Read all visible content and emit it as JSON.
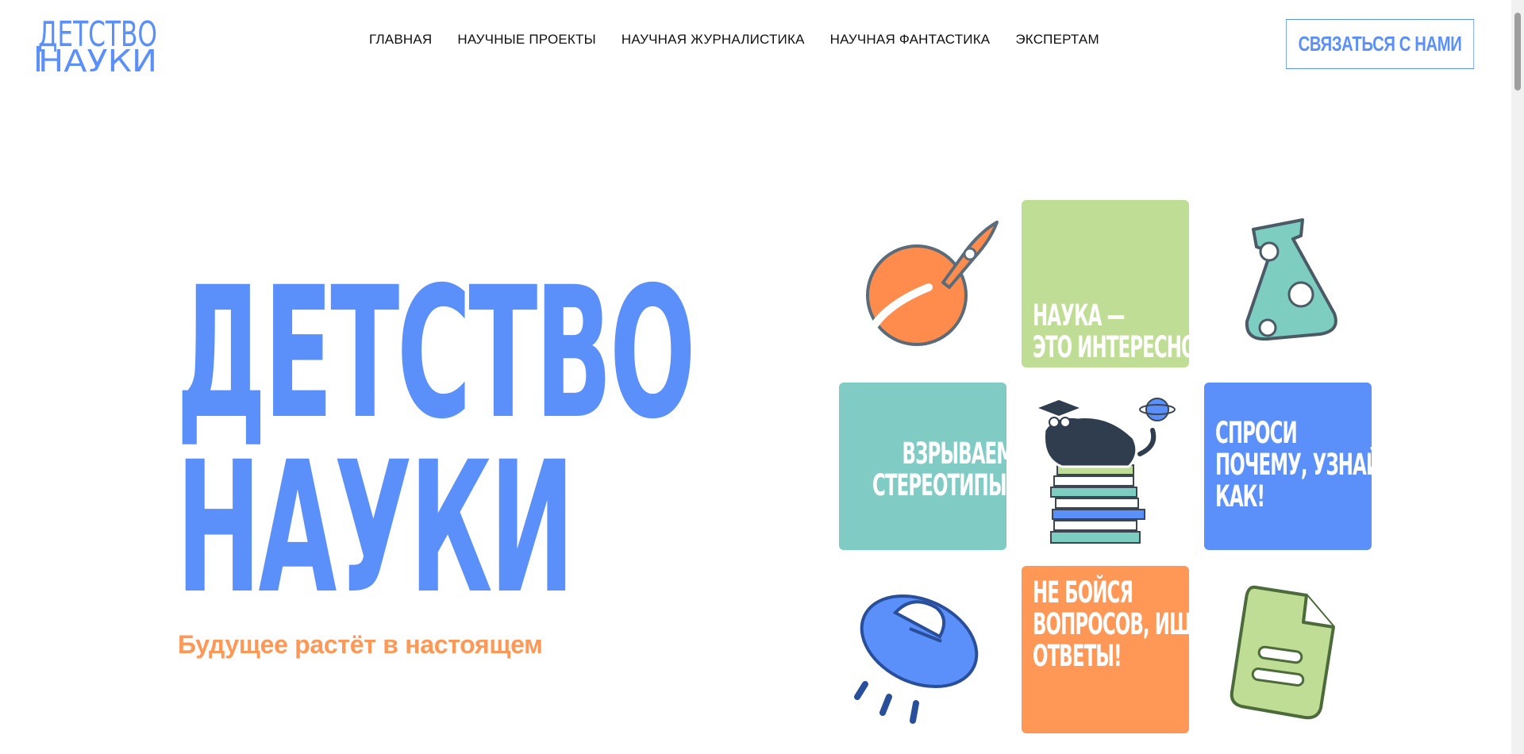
{
  "logo": {
    "line1": "ДЕТСТВО",
    "line2": "НАУКИ",
    "color": "#5b8ff9"
  },
  "nav": {
    "items": [
      {
        "label": "ГЛАВНАЯ"
      },
      {
        "label": "НАУЧНЫЕ ПРОЕКТЫ"
      },
      {
        "label": "НАУЧНАЯ ЖУРНАЛИСТИКА"
      },
      {
        "label": "НАУЧНАЯ ФАНТАСТИКА"
      },
      {
        "label": "ЭКСПЕРТАМ"
      }
    ]
  },
  "header": {
    "contact_label": "СВЯЗАТЬСЯ С НАМИ"
  },
  "hero": {
    "title_line1": "ДЕТСТВО",
    "title_line2": "НАУКИ",
    "subtitle": "Будущее растёт в настоящем"
  },
  "tiles": {
    "green": {
      "line1": "НАУКА —",
      "line2": "ЭТО ИНТЕРЕСНО!"
    },
    "teal": {
      "line1": "ВЗРЫВАЕМ",
      "line2": "СТЕРЕОТИПЫ!"
    },
    "blue": {
      "line1": "СПРОСИ",
      "line2": "ПОЧЕМУ, УЗНАЙ",
      "line3": "КАК!"
    },
    "orange": {
      "line1": "НЕ БОЙСЯ",
      "line2": "ВОПРОСОВ, ИЩИ",
      "line3": "ОТВЕТЫ!"
    }
  },
  "stickers": [
    {
      "icon": "planet-rocket-icon"
    },
    {
      "icon": "flask-icon"
    },
    {
      "icon": "cat-on-books-icon"
    },
    {
      "icon": "ufo-icon"
    },
    {
      "icon": "document-icon"
    }
  ],
  "colors": {
    "accent_blue": "#5b8ff9",
    "accent_orange": "#ff9757",
    "tile_green": "#c0dd95",
    "tile_teal": "#80ccc4"
  }
}
